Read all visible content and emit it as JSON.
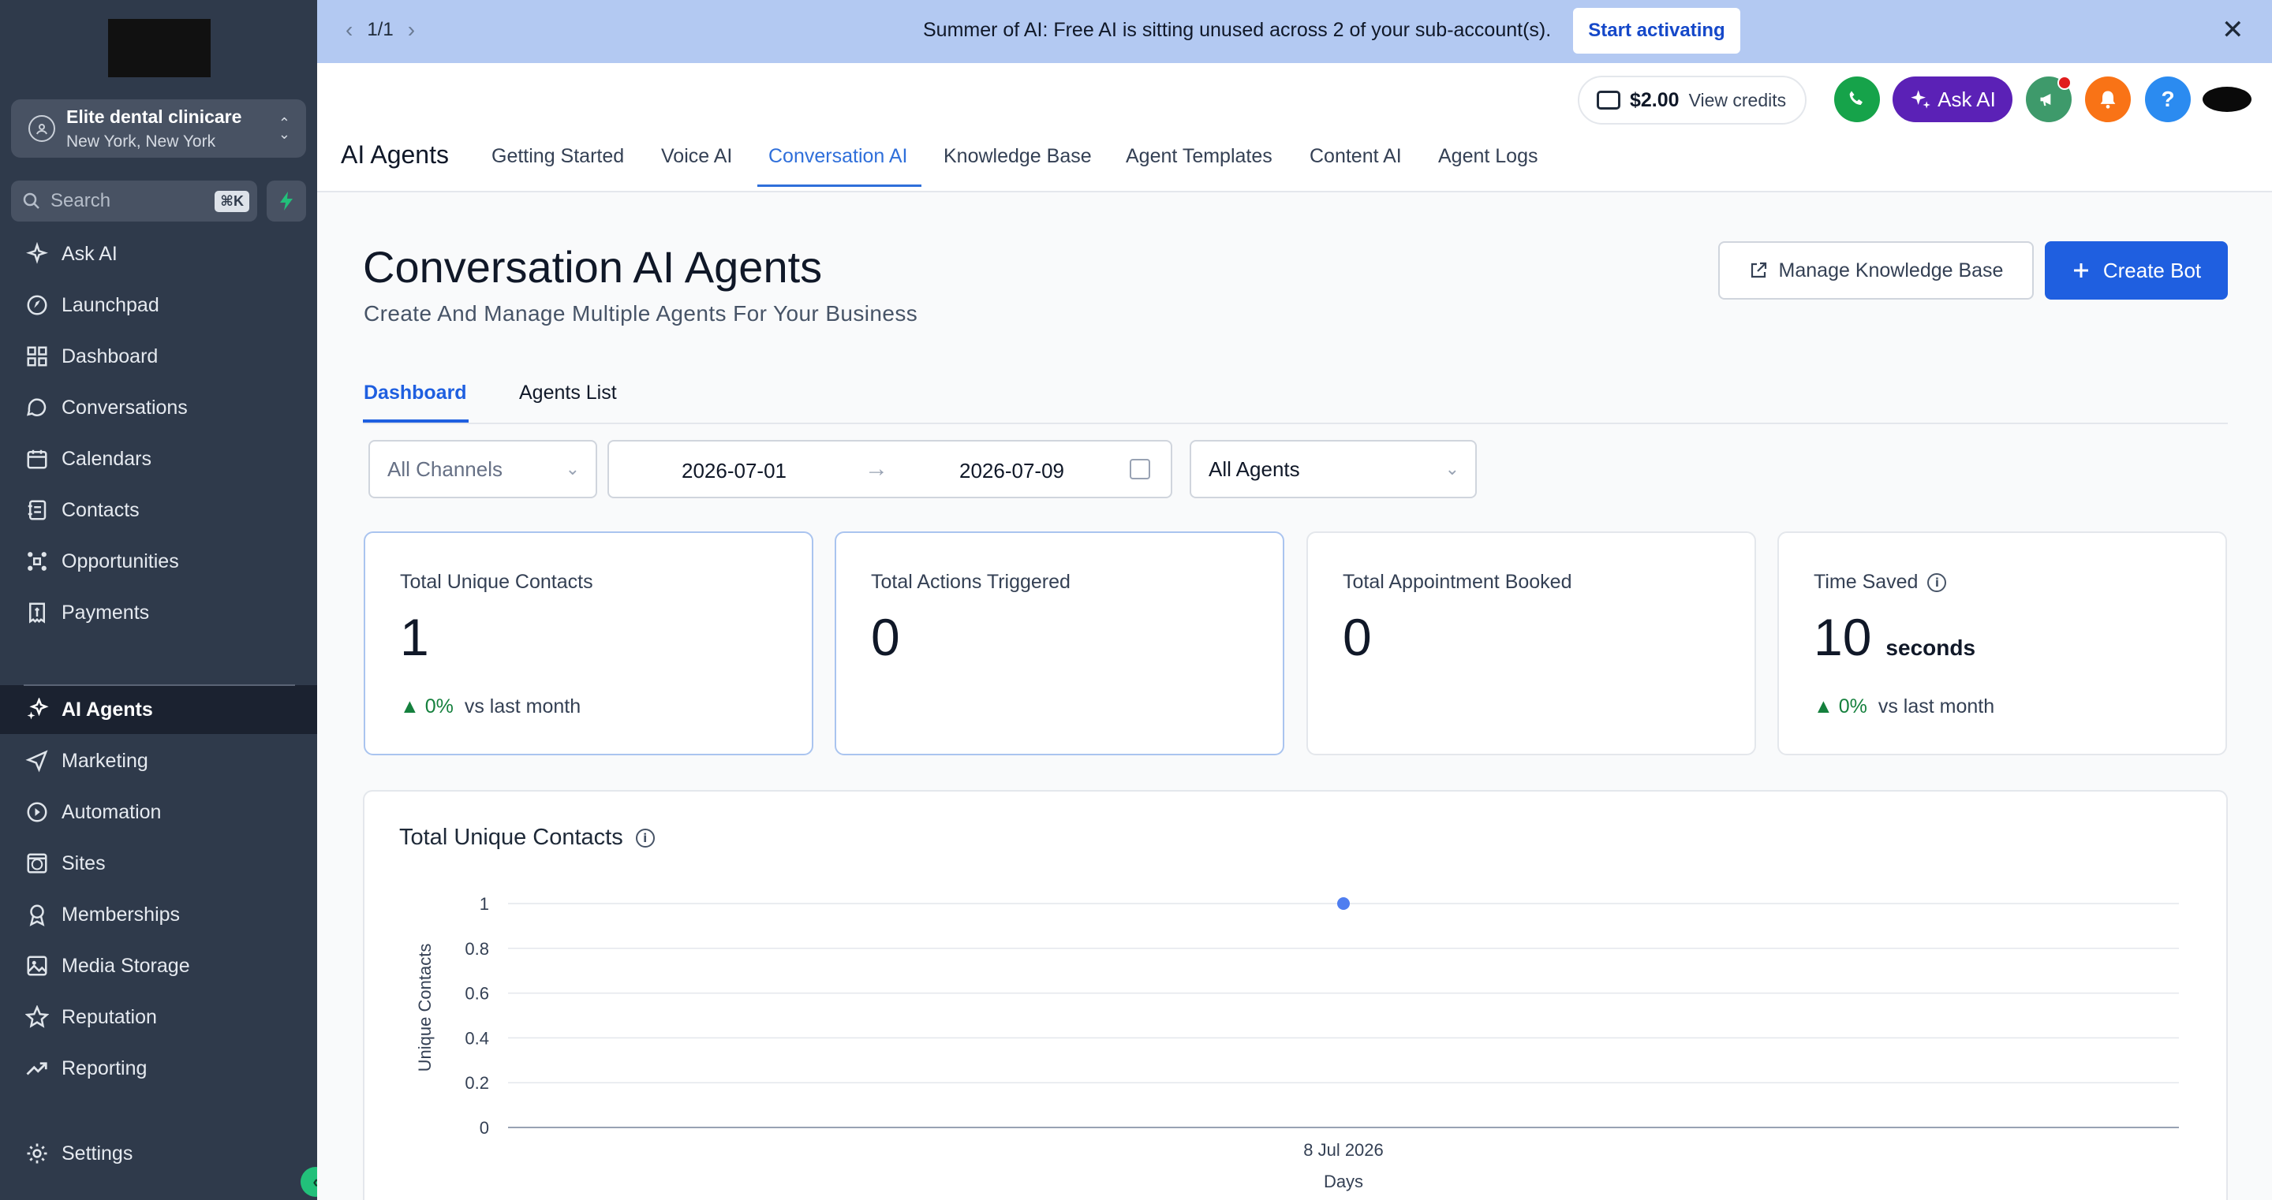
{
  "sidebar": {
    "account": {
      "name": "Elite dental clinicare",
      "location": "New York, New York"
    },
    "search": {
      "placeholder": "Search",
      "shortcut": "⌘K"
    },
    "items": [
      {
        "label": "Ask AI",
        "icon": "sparkle-icon"
      },
      {
        "label": "Launchpad",
        "icon": "rocket-icon"
      },
      {
        "label": "Dashboard",
        "icon": "grid-icon"
      },
      {
        "label": "Conversations",
        "icon": "chat-bubble-icon"
      },
      {
        "label": "Calendars",
        "icon": "calendar-icon"
      },
      {
        "label": "Contacts",
        "icon": "contacts-icon"
      },
      {
        "label": "Opportunities",
        "icon": "network-icon"
      },
      {
        "label": "Payments",
        "icon": "receipt-icon"
      },
      {
        "label": "AI Agents",
        "icon": "ai-sparkle-icon",
        "active": true
      },
      {
        "label": "Marketing",
        "icon": "send-icon"
      },
      {
        "label": "Automation",
        "icon": "automation-icon"
      },
      {
        "label": "Sites",
        "icon": "globe-icon"
      },
      {
        "label": "Memberships",
        "icon": "award-icon"
      },
      {
        "label": "Media Storage",
        "icon": "image-icon"
      },
      {
        "label": "Reputation",
        "icon": "star-icon"
      },
      {
        "label": "Reporting",
        "icon": "trend-icon"
      },
      {
        "label": "Settings",
        "icon": "gear-icon"
      }
    ]
  },
  "banner": {
    "pager": "1/1",
    "message": "Summer of AI: Free AI is sitting unused across 2 of your sub-account(s).",
    "cta": "Start activating",
    "bg_color": "#b3c9f2"
  },
  "header": {
    "credits_amount": "$2.00",
    "credits_link": "View credits",
    "ask_ai": "Ask AI",
    "help": "?",
    "page_title": "AI Agents",
    "tabs": [
      "Getting Started",
      "Voice AI",
      "Conversation AI",
      "Knowledge Base",
      "Agent Templates",
      "Content AI",
      "Agent Logs"
    ],
    "active_tab": "Conversation AI"
  },
  "main": {
    "title": "Conversation AI Agents",
    "subtitle": "Create And Manage Multiple Agents For Your Business",
    "manage_kb": "Manage Knowledge Base",
    "create_bot": "Create Bot",
    "subtabs": [
      "Dashboard",
      "Agents List"
    ],
    "filters": {
      "channels": "All Channels",
      "date_start": "2026-07-01",
      "date_end": "2026-07-09",
      "agents": "All Agents"
    },
    "cards": [
      {
        "label": "Total Unique Contacts",
        "value": "1",
        "trend": "0%",
        "trend_text": "vs last month"
      },
      {
        "label": "Total Actions Triggered",
        "value": "0"
      },
      {
        "label": "Total Appointment Booked",
        "value": "0"
      },
      {
        "label": "Time Saved",
        "value": "10",
        "unit": "seconds",
        "trend": "0%",
        "trend_text": "vs last month"
      }
    ]
  },
  "chart_data": {
    "type": "line",
    "title": "Total Unique Contacts",
    "xlabel": "Days",
    "ylabel": "Unique Contacts",
    "x": [
      "8 Jul 2026"
    ],
    "series": [
      {
        "values": [
          1
        ]
      }
    ],
    "ylim": [
      0,
      1
    ],
    "yticks": [
      "1",
      "0.8",
      "0.6",
      "0.4",
      "0.2",
      "0"
    ],
    "grid": true,
    "color": "#4f7ef0"
  },
  "colors": {
    "accent": "#1f5fe0",
    "sidebar": "#2f3a4b",
    "success": "#15803d"
  }
}
